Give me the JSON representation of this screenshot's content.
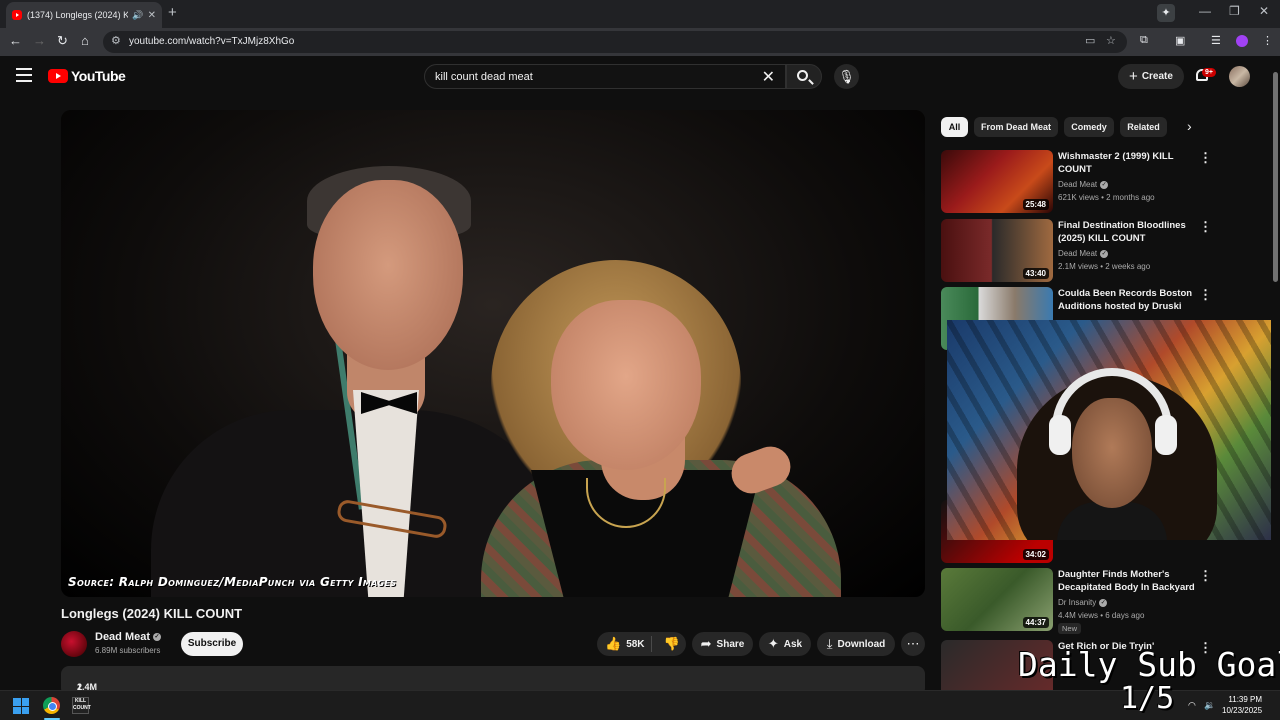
{
  "browser": {
    "tab_title": "(1374) Longlegs (2024) KILL...",
    "url": "youtube.com/watch?v=TxJMjz8XhGo"
  },
  "header": {
    "logo_text": "YouTube",
    "search_query": "kill count dead meat",
    "create_label": "Create",
    "notification_count": "9+"
  },
  "video": {
    "source_caption": "Source: Ralph Dominguez/MediaPunch via Getty Images",
    "title": "Longlegs (2024) KILL COUNT",
    "channel": "Dead Meat",
    "subscribers": "6.89M subscribers",
    "subscribe_label": "Subscribe",
    "likes": "58K",
    "share_label": "Share",
    "ask_label": "Ask",
    "download_label": "Download",
    "views": "1.4M views",
    "age": "2 months ago"
  },
  "chips": [
    "All",
    "From Dead Meat",
    "Comedy",
    "Related"
  ],
  "recommendations": [
    {
      "title": "Wishmaster 2 (1999) KILL COUNT",
      "channel": "Dead Meat",
      "meta": "621K views • 2 months ago",
      "duration": "25:48"
    },
    {
      "title": "Final Destination Bloodlines (2025) KILL COUNT",
      "channel": "Dead Meat",
      "meta": "2.1M views • 2 weeks ago",
      "duration": "43:40"
    },
    {
      "title": "Coulda Been Records Boston Auditions hosted by Druski",
      "channel": "",
      "meta": "",
      "duration": ""
    },
    {
      "title": "",
      "channel": "",
      "meta": "",
      "duration": "34:02"
    },
    {
      "title": "Daughter Finds Mother's Decapitated Body In Backyard",
      "channel": "Dr Insanity",
      "meta": "4.4M views • 6 days ago",
      "duration": "44:37",
      "badge": "New"
    },
    {
      "title": "Get Rich or Die Tryin'",
      "channel": "",
      "meta": "",
      "duration": ""
    }
  ],
  "overlay": {
    "goal_label": "Daily Sub Goal",
    "goal_progress": "1/5"
  },
  "taskbar": {
    "time": "11:39 PM",
    "date": "10/23/2025"
  }
}
